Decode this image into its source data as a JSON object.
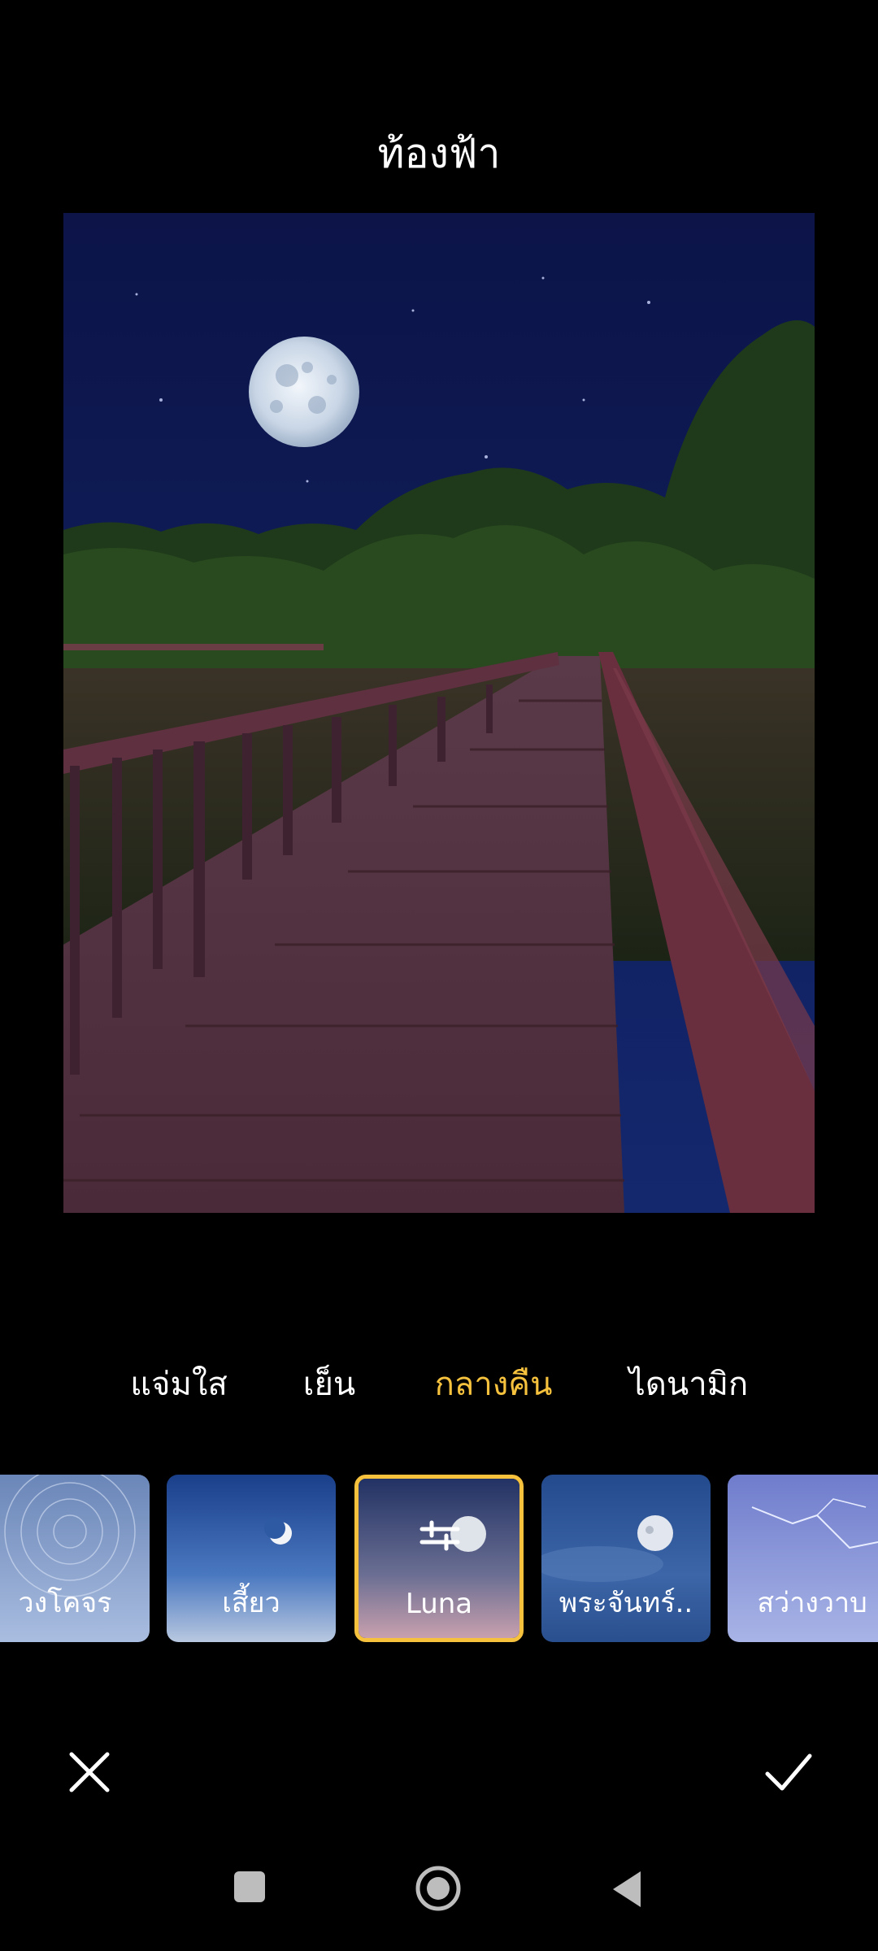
{
  "header": {
    "title": "ท้องฟ้า"
  },
  "style_tabs": [
    {
      "label": "แจ่มใส",
      "active": false
    },
    {
      "label": "เย็น",
      "active": false
    },
    {
      "label": "กลางคืน",
      "active": true
    },
    {
      "label": "ไดนามิก",
      "active": false
    }
  ],
  "sky_presets": [
    {
      "label": "วงโคจร",
      "icon": "star-trails",
      "selected": false
    },
    {
      "label": "เสี้ยว",
      "icon": "crescent-moon",
      "selected": false
    },
    {
      "label": "Luna",
      "icon": "adjust-sliders-icon",
      "selected": true
    },
    {
      "label": "พระจันทร์..",
      "icon": "full-moon",
      "selected": false
    },
    {
      "label": "สว่างวาบ",
      "icon": "lightning",
      "selected": false
    }
  ],
  "actions": {
    "cancel_icon": "close-icon",
    "confirm_icon": "check-icon"
  },
  "system_nav": {
    "recents_icon": "square-icon",
    "home_icon": "circle-icon",
    "back_icon": "triangle-back-icon"
  },
  "colors": {
    "accent": "#f6c23e",
    "background": "#000000"
  }
}
